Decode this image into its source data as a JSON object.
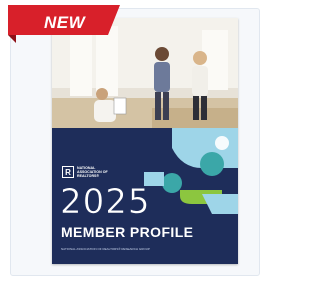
{
  "badge": {
    "label": "NEW",
    "color": "#d8202a"
  },
  "cover": {
    "logo_mark": "R",
    "logo_text": "NATIONAL ASSOCIATION OF REALTORS®",
    "year": "2025",
    "title": "MEMBER PROFILE",
    "footer": "NATIONAL ASSOCIATION OF REALTORS® RESEARCH GROUP"
  },
  "colors": {
    "navy": "#1e2d5a",
    "teal": "#3ba7a8",
    "light_blue": "#9ed5e8",
    "green": "#8cc63f"
  }
}
